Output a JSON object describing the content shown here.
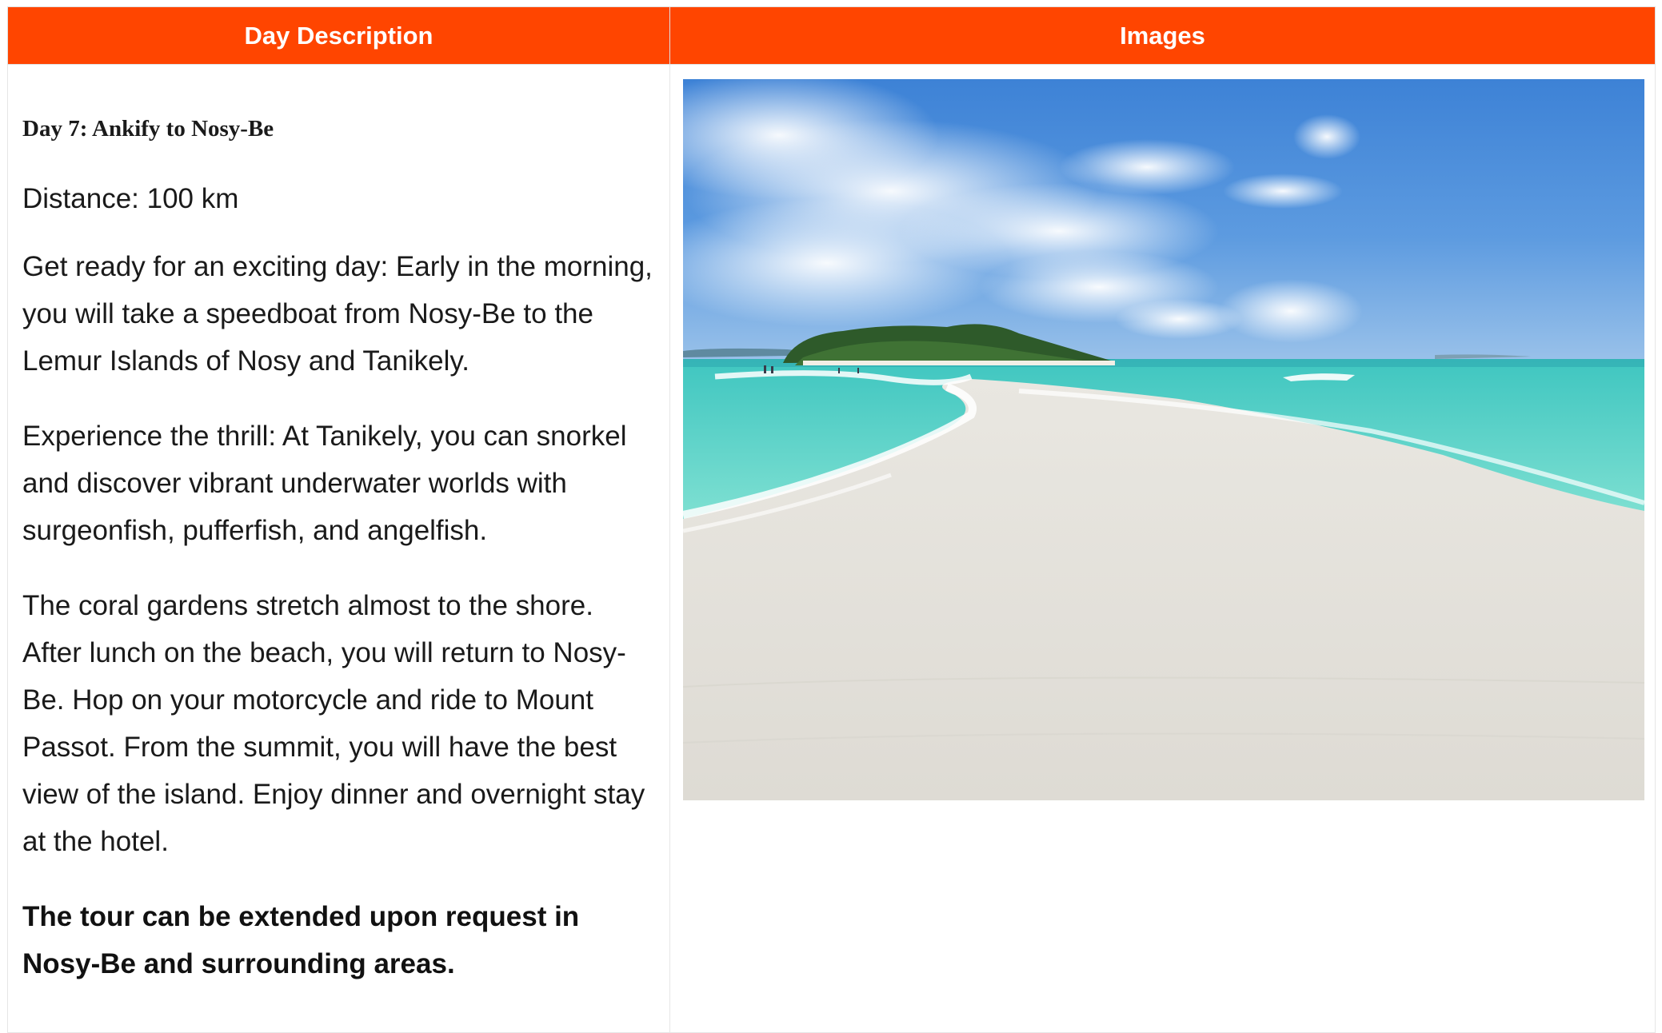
{
  "table": {
    "headers": {
      "description": "Day Description",
      "images": "Images"
    }
  },
  "day": {
    "title": "Day 7: Ankify to Nosy-Be",
    "distance": "Distance: 100 km",
    "paragraphs": [
      "Get ready for an exciting day: Early in the morning, you will take a speedboat from Nosy-Be to the Lemur Islands of Nosy and Tanikely.",
      "Experience the thrill: At Tanikely, you can snorkel and discover vibrant underwater worlds with surgeonfish, pufferfish, and angelfish.",
      "The coral gardens stretch almost to the shore. After lunch on the beach, you will return to Nosy-Be. Hop on your motorcycle and ride to Mount Passot. From the summit, you will have the best view of the island. Enjoy dinner and overnight stay at the hotel."
    ],
    "note": "The tour can be extended upon request in Nosy-Be and surrounding areas."
  },
  "image": {
    "subject": "beach-sandbar-island-photo"
  },
  "colors": {
    "header_bg": "#ff4500",
    "header_text": "#ffffff",
    "body_text": "#1a1a1a",
    "border": "#e6e6e6"
  }
}
